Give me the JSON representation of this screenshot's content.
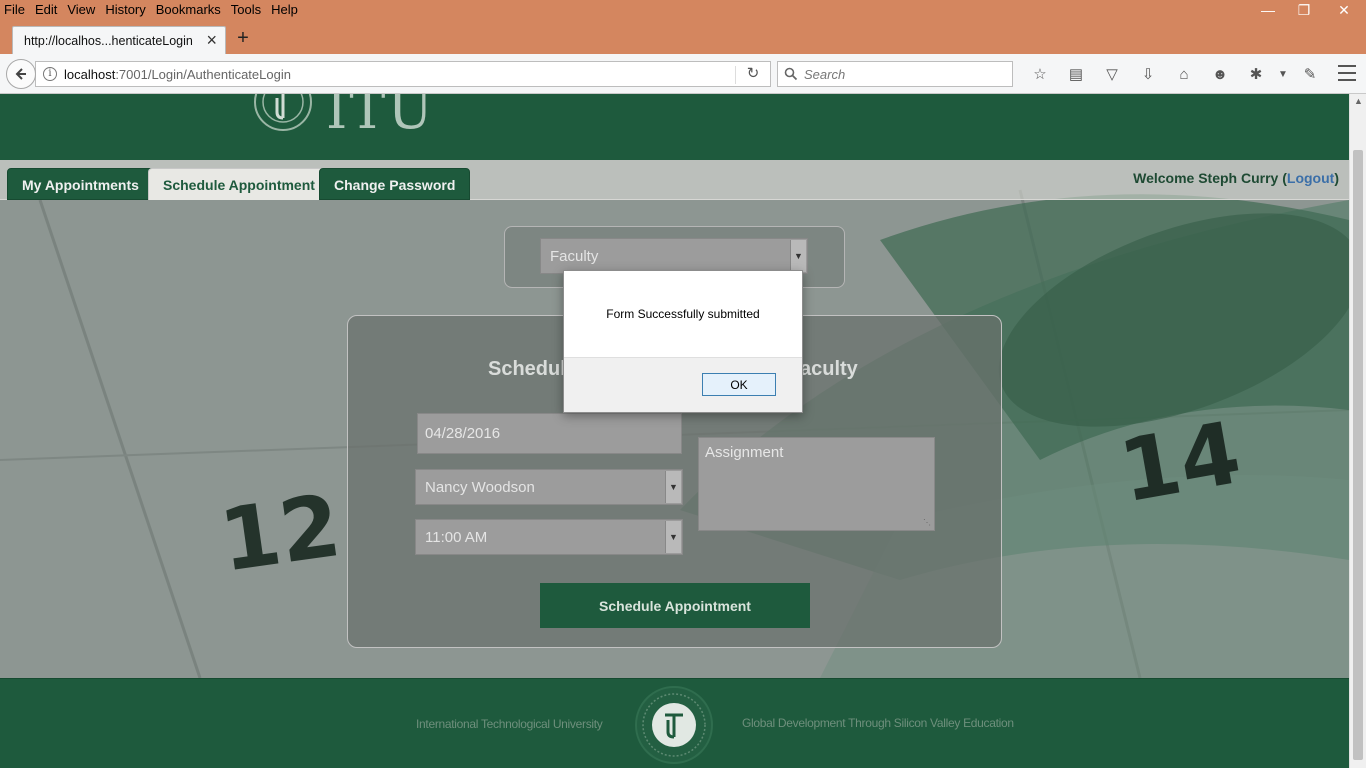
{
  "browser": {
    "menu": [
      "File",
      "Edit",
      "View",
      "History",
      "Bookmarks",
      "Tools",
      "Help"
    ],
    "tab_title": "http://localhos...henticateLogin",
    "url_host": "localhost",
    "url_path": ":7001/Login/AuthenticateLogin",
    "search_placeholder": "Search"
  },
  "site": {
    "logo_text": "ITU",
    "tabs": [
      "My Appointments",
      "Schedule Appointment",
      "Change Password"
    ],
    "welcome_prefix": "Welcome Steph Curry (",
    "logout_label": "Logout",
    "welcome_suffix": ")"
  },
  "form": {
    "faculty_select": "Faculty",
    "title_left": "Schedul",
    "title_right": "aculty",
    "date_value": "04/28/2016",
    "faculty_name": "Nancy Woodson",
    "time_value": "11:00 AM",
    "notes_placeholder": "Assignment",
    "submit_label": "Schedule Appointment"
  },
  "background": {
    "numbers": [
      "12",
      "14"
    ]
  },
  "footer": {
    "left_text": "International Technological University",
    "right_text": "Global Development Through Silicon Valley Education"
  },
  "dialog": {
    "message": "Form Successfully submitted",
    "ok_label": "OK"
  },
  "colors": {
    "brand_green": "#1e5a3d",
    "chrome_orange": "#d4865f",
    "link_blue": "#3b6fa8"
  }
}
